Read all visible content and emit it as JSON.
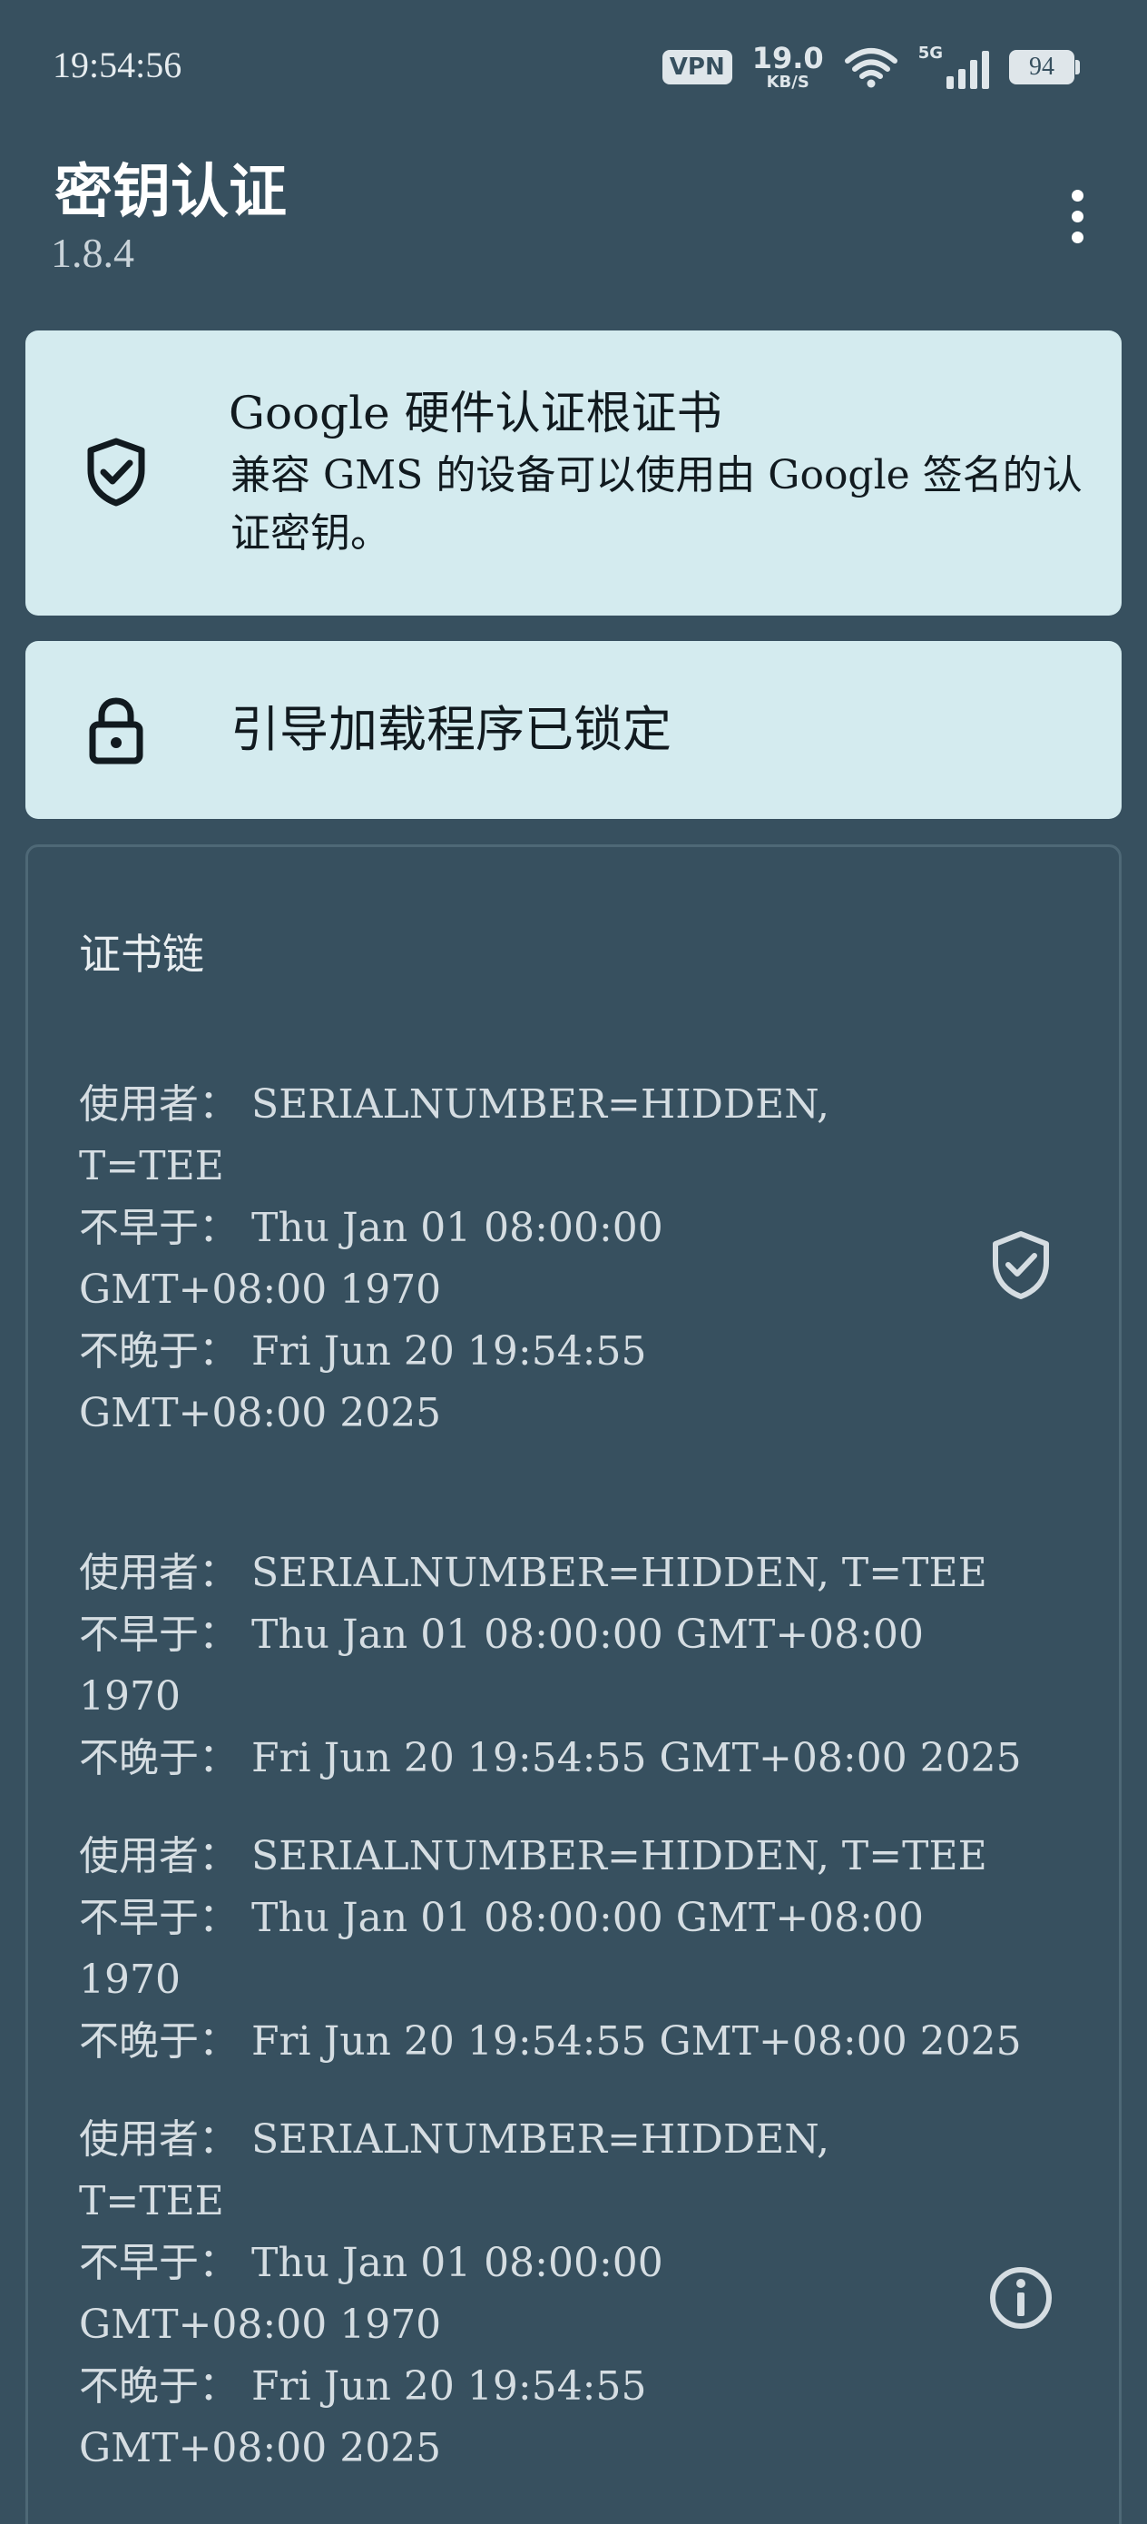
{
  "status_bar": {
    "time": "19:54:56",
    "vpn": "VPN",
    "speed_value": "19.0",
    "speed_unit": "KB/S",
    "network": "5G",
    "battery": "94"
  },
  "app_bar": {
    "title": "密钥认证",
    "version": "1.8.4",
    "menu_icon": "more-vert-icon"
  },
  "gms_card": {
    "icon": "shield-check-icon",
    "title": "Google 硬件认证根证书",
    "description": "兼容 GMS 的设备可以使用由 Google 签名的认证密钥。"
  },
  "bootloader_card": {
    "icon": "lock-icon",
    "label": "引导加载程序已锁定"
  },
  "cert_chain": {
    "title": "证书链",
    "certs": [
      {
        "subject": "使用者： SERIALNUMBER=HIDDEN, T=TEE",
        "not_before": "不早于： Thu Jan 01 08:00:00 GMT+08:00 1970",
        "not_after": "不晚于： Fri Jun 20 19:54:55 GMT+08:00 2025",
        "status_icon": "shield-check-icon"
      },
      {
        "subject": "使用者： SERIALNUMBER=HIDDEN, T=TEE",
        "not_before": "不早于： Thu Jan 01 08:00:00 GMT+08:00 1970",
        "not_after": "不晚于： Fri Jun 20 19:54:55 GMT+08:00 2025"
      },
      {
        "subject": "使用者： SERIALNUMBER=HIDDEN, T=TEE",
        "not_before": "不早于： Thu Jan 01 08:00:00 GMT+08:00 1970",
        "not_after": "不晚于： Fri Jun 20 19:54:55 GMT+08:00 2025"
      },
      {
        "subject": "使用者： SERIALNUMBER=HIDDEN, T=TEE",
        "not_before": "不早于： Thu Jan 01 08:00:00 GMT+08:00 1970",
        "not_after": "不晚于： Fri Jun 20 19:54:55 GMT+08:00 2025",
        "status_icon": "info-icon"
      }
    ]
  },
  "colors": {
    "background": "#37505f",
    "card_light": "#d4ebef",
    "text_dark": "#111a1f",
    "text_light": "#d5dde2"
  }
}
